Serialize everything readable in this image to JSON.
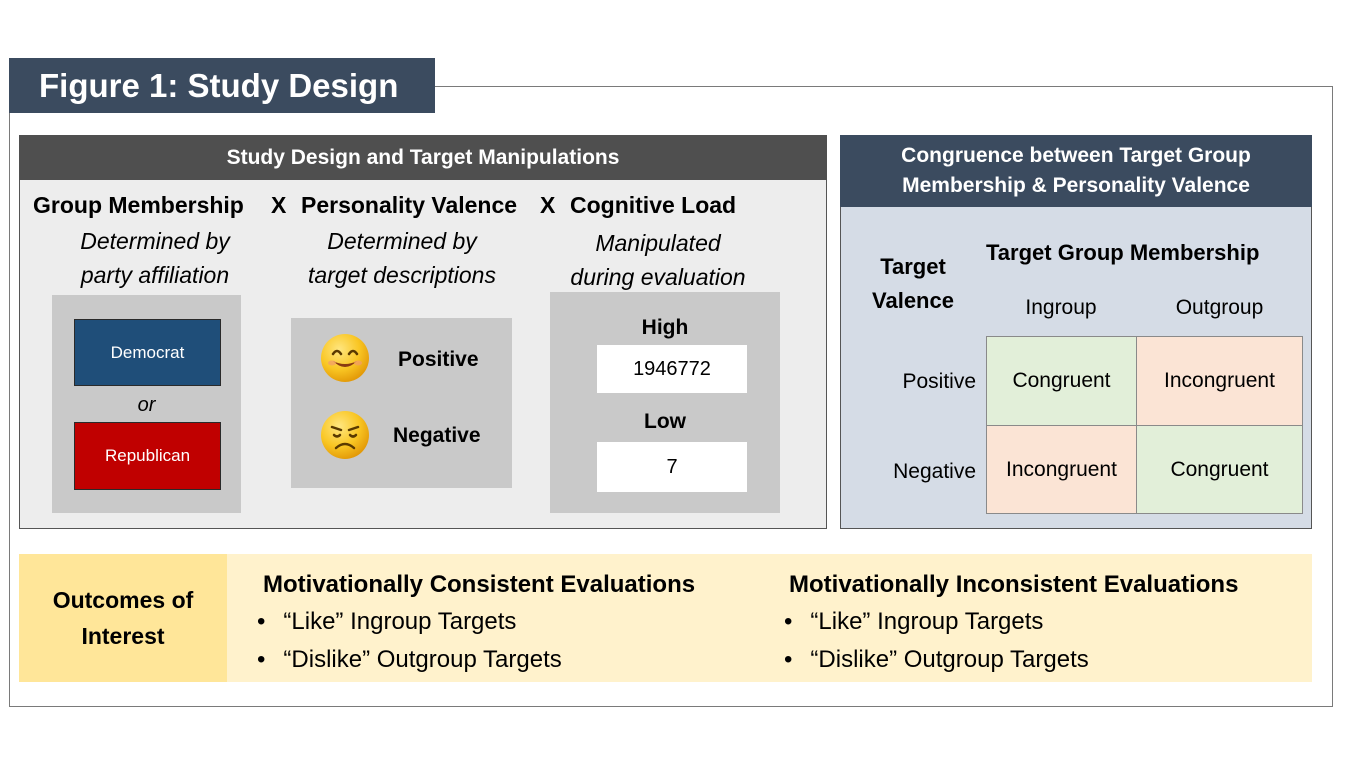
{
  "figure": {
    "title": "Figure 1: Study Design"
  },
  "study_design": {
    "header": "Study Design and Target Manipulations",
    "x_symbol": "X",
    "group_membership": {
      "title": "Group Membership",
      "desc_line1": "Determined by",
      "desc_line2": "party affiliation",
      "option1": "Democrat",
      "or_label": "or",
      "option2": "Republican"
    },
    "personality_valence": {
      "title": "Personality Valence",
      "desc_line1": "Determined by",
      "desc_line2": "target descriptions",
      "positive": "Positive",
      "negative": "Negative"
    },
    "cognitive_load": {
      "title": "Cognitive Load",
      "desc_line1": "Manipulated",
      "desc_line2": "during evaluation",
      "high_label": "High",
      "high_value": "1946772",
      "low_label": "Low",
      "low_value": "7"
    }
  },
  "congruence": {
    "header_line1": "Congruence between Target Group",
    "header_line2": "Membership & Personality Valence",
    "row_title_line1": "Target",
    "row_title_line2": "Valence",
    "col_title": "Target Group Membership",
    "columns": [
      "Ingroup",
      "Outgroup"
    ],
    "rows": [
      {
        "label": "Positive",
        "cells": [
          "Congruent",
          "Incongruent"
        ]
      },
      {
        "label": "Negative",
        "cells": [
          "Incongruent",
          "Congruent"
        ]
      }
    ]
  },
  "outcomes": {
    "label_line1": "Outcomes of",
    "label_line2": "Interest",
    "consistent": {
      "title": "Motivationally Consistent Evaluations",
      "bullets": [
        "“Like” Ingroup Targets",
        "“Dislike” Outgroup Targets"
      ]
    },
    "inconsistent": {
      "title": "Motivationally Inconsistent Evaluations",
      "bullets": [
        "“Like” Ingroup Targets",
        "“Dislike” Outgroup Targets"
      ]
    },
    "bullet_symbol": "•"
  },
  "colors": {
    "title_tab": "#3b4b5f",
    "left_header": "#4f4f4f",
    "democrat": "#1f4e79",
    "republican": "#c00000",
    "congruent": "#e2efd9",
    "incongruent": "#fbe4d5",
    "outcomes_label": "#ffe699",
    "outcomes_bar": "#fff2cc"
  },
  "icons": {
    "positive": "smiling-face-icon",
    "negative": "frowning-face-icon"
  }
}
